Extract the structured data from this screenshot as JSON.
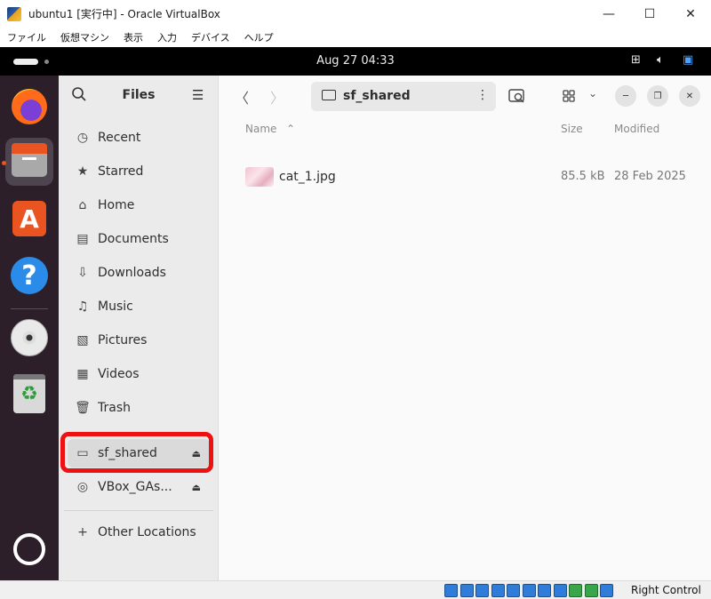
{
  "window": {
    "title": "ubuntu1 [実行中] - Oracle VirtualBox",
    "minimize": "—",
    "maximize": "☐",
    "close": "✕"
  },
  "menubar": [
    "ファイル",
    "仮想マシン",
    "表示",
    "入力",
    "デバイス",
    "ヘルプ"
  ],
  "topbar": {
    "clock": "Aug 27  04:33",
    "tray_icons": [
      "network-icon",
      "volume-icon",
      "accessibility-icon"
    ]
  },
  "dock": {
    "apps": [
      "firefox-icon",
      "files-icon",
      "app-center-icon",
      "help-icon",
      "disc-icon",
      "trash-icon",
      "show-apps-icon"
    ]
  },
  "sidebar": {
    "title": "Files",
    "items": [
      {
        "label": "Recent",
        "icon": "clock-icon"
      },
      {
        "label": "Starred",
        "icon": "star-icon"
      },
      {
        "label": "Home",
        "icon": "home-icon"
      },
      {
        "label": "Documents",
        "icon": "document-icon"
      },
      {
        "label": "Downloads",
        "icon": "download-icon"
      },
      {
        "label": "Music",
        "icon": "music-icon"
      },
      {
        "label": "Pictures",
        "icon": "picture-icon"
      },
      {
        "label": "Videos",
        "icon": "video-icon"
      },
      {
        "label": "Trash",
        "icon": "trash-icon"
      }
    ],
    "mounts": [
      {
        "label": "sf_shared",
        "icon": "drive-icon"
      },
      {
        "label": "VBox_GAs...",
        "icon": "disc-icon"
      }
    ],
    "other": "Other Locations"
  },
  "pathbar": {
    "current": "sf_shared"
  },
  "columns": {
    "name": "Name",
    "size": "Size",
    "modified": "Modified"
  },
  "files": [
    {
      "name": "cat_1.jpg",
      "size": "85.5 kB",
      "modified": "28 Feb 2025"
    }
  ],
  "statusbar": {
    "host_key": "Right Control"
  },
  "colors": {
    "highlight": "#ee1111",
    "ubuntu_orange": "#e95420",
    "dock_bg": "#2c1f2a"
  }
}
